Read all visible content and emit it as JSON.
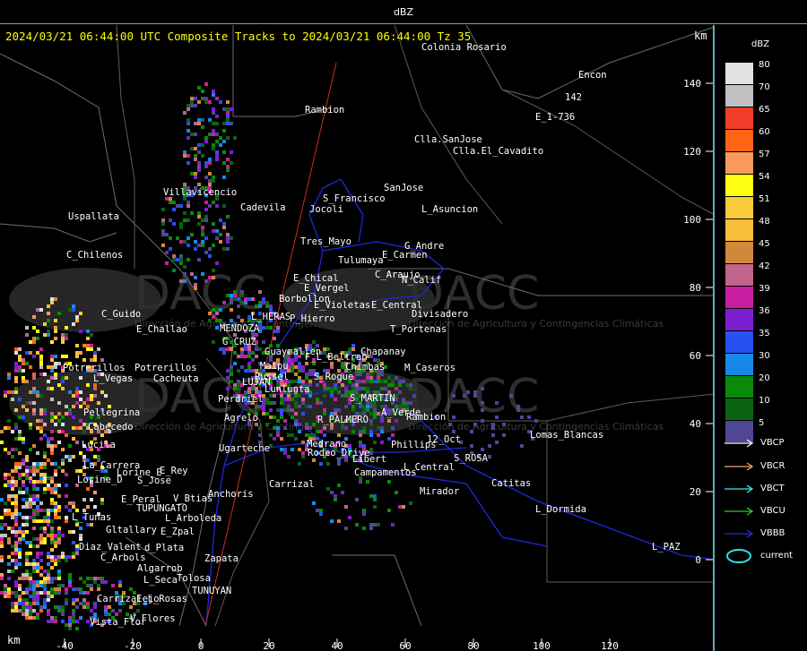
{
  "header": {
    "title": "dBZ"
  },
  "map": {
    "title": "2024/03/21 06:44:00 UTC Composite Tracks to 2024/03/21 06:44:00 Tz 35",
    "km_label_top": "km",
    "km_label_bottom": "km",
    "y_ticks": [
      "140",
      "120",
      "100",
      "80",
      "60",
      "40",
      "20",
      "0"
    ],
    "x_ticks": [
      "-40",
      "-20",
      "0",
      "20",
      "40",
      "60",
      "80",
      "100",
      "120"
    ],
    "watermark": "DACC",
    "watermark_sub": "Dirección de Agricultura y Contingencias Climáticas",
    "places": [
      "Colonia Rosario",
      "Encon",
      "142",
      "Rambion",
      "E_1-736",
      "Clla.SanJose",
      "Clla.El_Cavadito",
      "Villavicencio",
      "SanJose",
      "S_Francisco",
      "Uspallata",
      "Cadevila",
      "Jocoli",
      "L_Asuncion",
      "Tres_Mayo",
      "G_Andre",
      "Tulumaya",
      "E_Carmen",
      "C_Chilenos",
      "E_Chical",
      "C_Araujo",
      "E_Vergel",
      "N_Calif",
      "Borbollon",
      "E_Central",
      "Divisadero",
      "C_Guido",
      "MENDOZA",
      "L_HERAS",
      "P_Hierro",
      "E_Violetas",
      "E_Challao",
      "G_CRUZ",
      "T_Portenas",
      "Guaymallen",
      "Chapanay",
      "Maipu",
      "F_L_Beltran",
      "Potrerillos",
      "Chimbas",
      "M_Caseros",
      "L_Vegas",
      "Cacheuta",
      "Russel",
      "S_Roque",
      "Potrerillos",
      "LUJAN",
      "Lunlunta",
      "Perdriel",
      "S_MARTIN",
      "Pellegrina",
      "Cabecedo",
      "Agrelo",
      "R_PALMERO",
      "A_Verde",
      "Rambion",
      "Lucila",
      "Medrano",
      "Phillips",
      "12_Oct",
      "Lomas_Blancas",
      "Ugarteche",
      "Rodeo_Drive",
      "Libert",
      "L_Central",
      "S_ROSA",
      "La_Carrera",
      "E_Rey",
      "Campamentos",
      "Lorine_E",
      "Lorine_D",
      "S_Jose",
      "Carrizal",
      "Catitas",
      "Anchoris",
      "Mirador",
      "E_Peral",
      "V_Btias",
      "TUPUNGATO",
      "L_Dormida",
      "L_Tunas",
      "L_Arboleda",
      "Gltallary",
      "E_Zpal",
      "L_PAZ",
      "Diaz_Valent",
      "d_Plata",
      "C_Arbols",
      "Zapata",
      "Algarrob",
      "Tolosa",
      "L_Seca",
      "Carrizalejo",
      "E_L_Rosas",
      "TUNUYAN",
      "Vista_Flor",
      "V_Flores"
    ]
  },
  "legend": {
    "unit": "dBZ",
    "levels": [
      {
        "label": "80",
        "color": "#e2e2e2"
      },
      {
        "label": "70",
        "color": "#c0c0c0"
      },
      {
        "label": "65",
        "color": "#f03c28"
      },
      {
        "label": "60",
        "color": "#ff6414"
      },
      {
        "label": "57",
        "color": "#f89a5a"
      },
      {
        "label": "54",
        "color": "#ffff14"
      },
      {
        "label": "51",
        "color": "#f8cc3c"
      },
      {
        "label": "48",
        "color": "#f8be3a"
      },
      {
        "label": "45",
        "color": "#d0883c"
      },
      {
        "label": "42",
        "color": "#c0648c"
      },
      {
        "label": "39",
        "color": "#c81ea0"
      },
      {
        "label": "36",
        "color": "#7c1ed2"
      },
      {
        "label": "35",
        "color": "#2850f0"
      },
      {
        "label": "30",
        "color": "#1888e8"
      },
      {
        "label": "20",
        "color": "#0a8a0a"
      },
      {
        "label": "10",
        "color": "#0a6414"
      },
      {
        "label": "5",
        "color": "#504696"
      }
    ],
    "tracks": [
      {
        "label": "VBCP",
        "color": "#ffffff"
      },
      {
        "label": "VBCR",
        "color": "#f4a07a"
      },
      {
        "label": "VBCT",
        "color": "#40e8e8"
      },
      {
        "label": "VBCU",
        "color": "#32c832"
      },
      {
        "label": "VBBB",
        "color": "#2828e0"
      },
      {
        "label": "current",
        "color": "#30e0e0"
      }
    ]
  }
}
